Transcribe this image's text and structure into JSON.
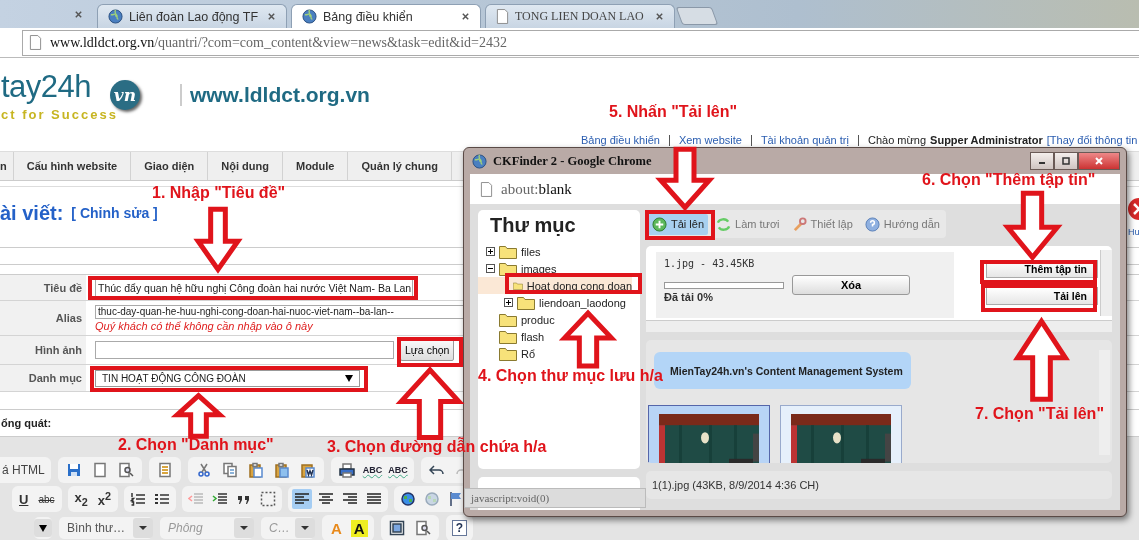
{
  "browser": {
    "tabs": [
      {
        "label": "Liên đoàn Lao động TF",
        "selected": false
      },
      {
        "label": "Bảng điều khiển",
        "selected": true
      },
      {
        "label": "TONG LIEN DOAN LAO",
        "selected": false
      }
    ],
    "url_host": "www.ldldct.org.vn",
    "url_path": "/quantri/?com=com_content&view=news&task=edit&id=2432"
  },
  "header": {
    "logo_name": "tay24h",
    "logo_slogan": "ct for Success",
    "logo_badge": "vn",
    "site": "www.ldldct.org.vn",
    "links": [
      "Bảng điều khiển",
      "Xem website",
      "Tài khoản quản trị"
    ],
    "welcome": "Chào mừng",
    "user": "Supper Administrator",
    "profile_link": "[Thay đổi thông tin"
  },
  "nav": [
    "n",
    "Cấu hình website",
    "Giao diện",
    "Nội dung",
    "Module",
    "Quản lý chung"
  ],
  "page_title": "ài viết:",
  "page_mode": "[ Chỉnh sửa ]",
  "form": [
    {
      "kind": "text",
      "label": "Tiêu đề",
      "value": "Thúc đẩy quan hệ hữu nghị Công đoàn hai nước Việt Nam- Ba Lan"
    },
    {
      "kind": "alias",
      "label": "Alias",
      "value": "thuc-day-quan-he-huu-nghi-cong-doan-hai-nuoc-viet-nam--ba-lan--",
      "hint": "Quý khách có thể không cần nhập vào ô này"
    },
    {
      "label": "Hình ảnh",
      "button": "Lựa chọn"
    },
    {
      "kind": "select",
      "label": "Danh mục",
      "value": "TIN HOẠT ĐỘNG CÔNG ĐOÀN"
    }
  ],
  "section_label": "ổng quát:",
  "editor": {
    "source": "á HTML",
    "spell": [
      "ABC",
      "ABC"
    ],
    "underline": "U",
    "strike": "abc",
    "subscript": "x$_{2}$",
    "superscript": "x$^{2}$",
    "align_buttons": [
      {
        "kind": "left",
        "selected": true
      },
      {
        "kind": "center",
        "selected": false
      },
      {
        "kind": "right",
        "selected": false
      },
      {
        "kind": "justify",
        "selected": false
      }
    ],
    "format": "Bình thư…",
    "font": "Phông",
    "size": "C…",
    "text_color": "A",
    "bg_color": "A",
    "help": "?"
  },
  "right_edge": {
    "label": "Hu"
  },
  "popup": {
    "title": "CKFinder 2 - Google Chrome",
    "url_scheme": "about:",
    "url_rest": "blank",
    "folders_title": "Thư mục",
    "folders": [
      {
        "kind": "branch",
        "label": "files",
        "expanded": false,
        "selected": false
      },
      {
        "kind": "branch",
        "label": "images",
        "expanded": true,
        "selected": false,
        "children": [
          {
            "kind": "leaf",
            "label": "Hoat dong cong doan",
            "selected": true
          },
          {
            "kind": "branch",
            "label": "liendoan_laodong",
            "expanded": false,
            "selected": false
          }
        ]
      },
      {
        "kind": "leaf",
        "label": "produc",
        "selected": false
      },
      {
        "kind": "leaf",
        "label": "flash",
        "selected": false
      },
      {
        "kind": "leaf",
        "label": "Rổ",
        "selected": false
      }
    ],
    "toolbar": [
      {
        "kind": "upload",
        "label": "Tải lên",
        "selected": true
      },
      {
        "kind": "refresh",
        "label": "Làm tươi",
        "selected": false
      },
      {
        "kind": "settings",
        "label": "Thiết lập",
        "selected": false
      },
      {
        "kind": "help",
        "label": "Hướng dẫn",
        "selected": false
      }
    ],
    "upload": {
      "file": "1.jpg - 43.45KB",
      "level": 0,
      "progress": "Đã tải 0%",
      "remove": "Xóa",
      "add_files": "Thêm tập tin",
      "upload": "Tải lên"
    },
    "banner": "MienTay24h.vn's Content Management System",
    "thumbnails": [
      {
        "kind": "picture",
        "selected": true
      },
      {
        "kind": "picture",
        "selected": false
      }
    ],
    "status": "1(1).jpg (43KB, 8/9/2014 4:36 CH)",
    "link_tooltip": "javascript:void(0)"
  },
  "annotations": [
    {
      "text": "1. Nhập \"Tiêu đề\"",
      "kind": "down"
    },
    {
      "text": "2. Chọn \"Danh mục\"",
      "kind": "up"
    },
    {
      "text": "3. Chọn đường dẫn chứa h/a",
      "kind": "up"
    },
    {
      "text": "4. Chọn thư mục lưu h/a",
      "kind": "up"
    },
    {
      "text": "5. Nhấn \"Tải lên\"",
      "kind": "down"
    },
    {
      "text": "6. Chọn \"Thêm tập tin\"",
      "kind": "down"
    },
    {
      "text": "7. Chọn \"Tải lên\"",
      "kind": "up"
    }
  ]
}
